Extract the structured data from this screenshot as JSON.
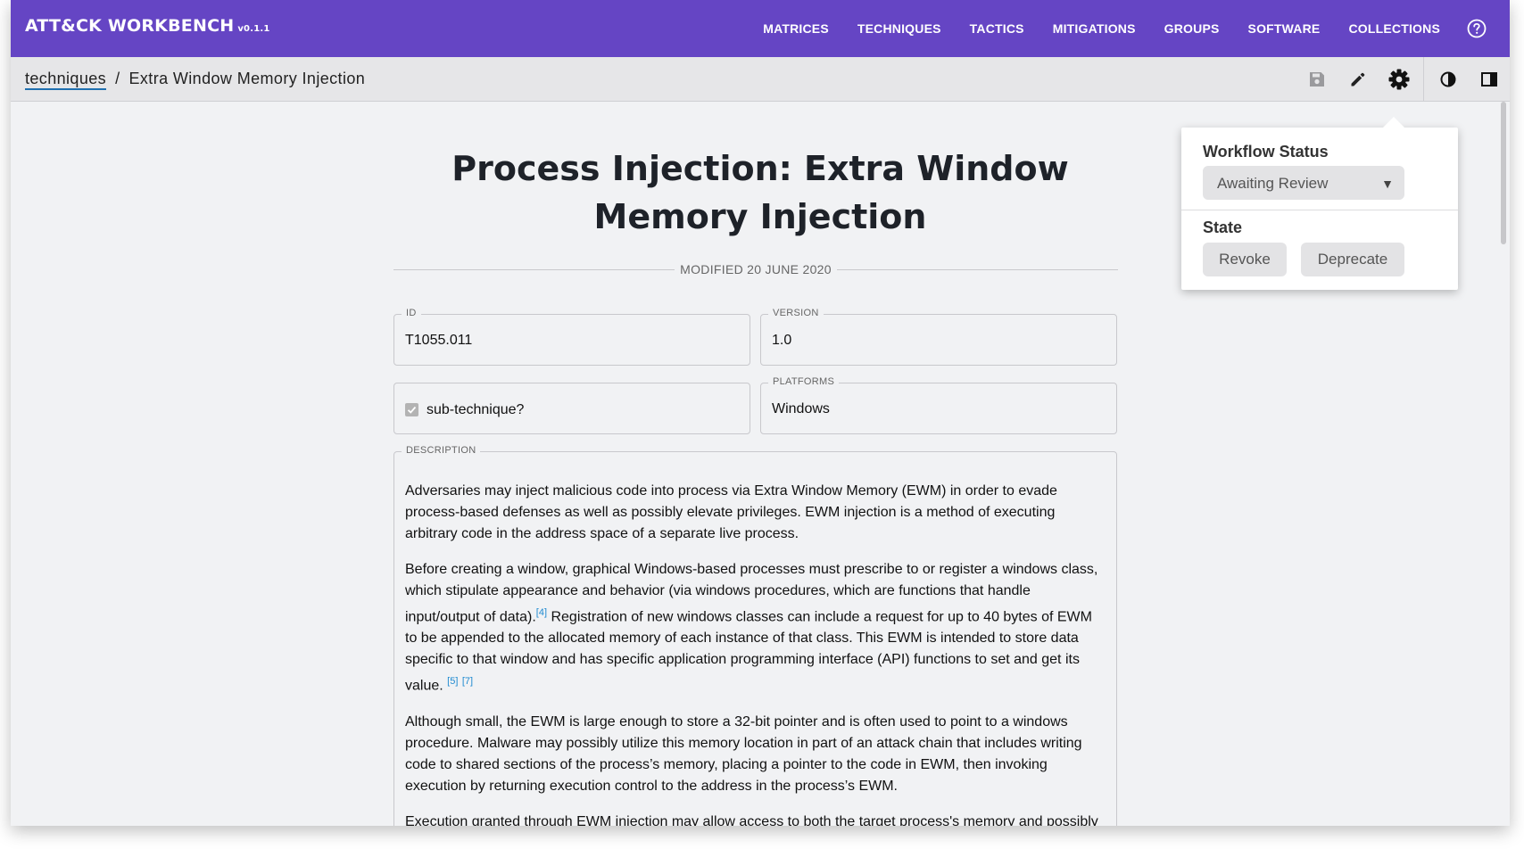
{
  "app": {
    "brand": "ATT&CK WORKBENCH",
    "version": "v0.1.1",
    "nav": [
      "MATRICES",
      "TECHNIQUES",
      "TACTICS",
      "MITIGATIONS",
      "GROUPS",
      "SOFTWARE",
      "COLLECTIONS"
    ],
    "accent": "#6545c4"
  },
  "breadcrumb": {
    "parent": "techniques",
    "separator": "/",
    "current": "Extra Window Memory Injection"
  },
  "toolbar": {
    "icons": [
      "save-icon",
      "edit-icon",
      "settings-icon",
      "contrast-icon",
      "sidebar-icon"
    ]
  },
  "page": {
    "title": "Process Injection: Extra Window Memory Injection",
    "modified": "MODIFIED 20 JUNE 2020",
    "id_label": "ID",
    "id_value": "T1055.011",
    "version_label": "VERSION",
    "version_value": "1.0",
    "subtechnique_label": "sub-technique?",
    "subtechnique_checked": true,
    "platforms_label": "PLATFORMS",
    "platforms_value": "Windows",
    "description_label": "DESCRIPTION",
    "description": {
      "p1": "Adversaries may inject malicious code into process via Extra Window Memory (EWM) in order to evade process-based defenses as well as possibly elevate privileges. EWM injection is a method of executing arbitrary code in the address space of a separate live process.",
      "p2a": "Before creating a window, graphical Windows-based processes must prescribe to or register a windows class, which stipulate appearance and behavior (via windows procedures, which are functions that handle input/output of data).",
      "ref4": "[4]",
      "p2b": " Registration of new windows classes can include a request for up to 40 bytes of EWM to be appended to the allocated memory of each instance of that class. This EWM is intended to store data specific to that window and has specific application programming interface (API) functions to set and get its value. ",
      "ref5": "[5]",
      "ref7": "[7]",
      "p3": "Although small, the EWM is large enough to store a 32-bit pointer and is often used to point to a windows procedure. Malware may possibly utilize this memory location in part of an attack chain that includes writing code to shared sections of the process’s memory, placing a pointer to the code in EWM, then invoking execution by returning execution control to the address in the process’s EWM.",
      "p4": "Execution granted through EWM injection may allow access to both the target process's memory and possibly"
    }
  },
  "popover": {
    "workflow_title": "Workflow Status",
    "workflow_value": "Awaiting Review",
    "state_title": "State",
    "revoke_label": "Revoke",
    "deprecate_label": "Deprecate"
  }
}
